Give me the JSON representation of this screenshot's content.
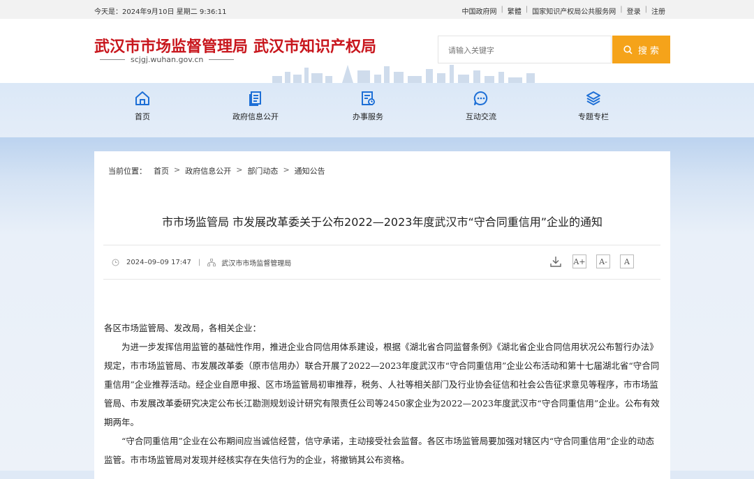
{
  "topbar": {
    "date": "今天是：2024年9月10日 星期二 9:36:11",
    "links": [
      "中国政府网",
      "繁體",
      "国家知识产权局公共服务网",
      "登录",
      "注册"
    ]
  },
  "header": {
    "logo_name1": "武汉市市场监督管理局",
    "logo_name2": "武汉市知识产权局",
    "logo_domain": "scjgj.wuhan.gov.cn",
    "search_placeholder": "请输入关键字",
    "search_button": "搜 索",
    "accent": "#c8161d",
    "search_color": "#f5a31a"
  },
  "nav": {
    "items": [
      {
        "label": "首页",
        "icon": "home-icon"
      },
      {
        "label": "政府信息公开",
        "icon": "document-icon"
      },
      {
        "label": "办事服务",
        "icon": "service-icon"
      },
      {
        "label": "互动交流",
        "icon": "chat-icon"
      },
      {
        "label": "专题专栏",
        "icon": "layers-icon"
      }
    ]
  },
  "breadcrumb": {
    "label": "当前位置：",
    "items": [
      "首页",
      "政府信息公开",
      "部门动态",
      "通知公告"
    ]
  },
  "article": {
    "title": "市市场监管局 市发展改革委关于公布2022—2023年度武汉市“守合同重信用”企业的通知",
    "date": "2024–09–09 17:47",
    "source": "武汉市市场监督管理局",
    "tools": [
      "download-icon",
      "A+",
      "A-",
      "A"
    ],
    "paragraphs": [
      "各区市场监管局、发改局，各相关企业：",
      "为进一步发挥信用监管的基础性作用，推进企业合同信用体系建设，根据《湖北省合同监督条例》《湖北省企业合同信用状况公布暂行办法》规定，市市场监管局、市发展改革委（原市信用办）联合开展了2022—2023年度武汉市“守合同重信用”企业公布活动和第十七届湖北省“守合同重信用”企业推荐活动。经企业自愿申报、区市场监管局初审推荐，税务、人社等相关部门及行业协会征信和社会公告征求意见等程序，市市场监管局、市发展改革委研究决定公布长江勘测规划设计研究有限责任公司等2450家企业为2022—2023年度武汉市“守合同重信用”企业。公布有效期两年。",
      "“守合同重信用”企业在公布期间应当诚信经营，信守承诺，主动接受社会监督。各区市场监管局要加强对辖区内“守合同重信用”企业的动态监管。市市场监管局对发现并经核实存在失信行为的企业，将撤销其公布资格。"
    ]
  }
}
